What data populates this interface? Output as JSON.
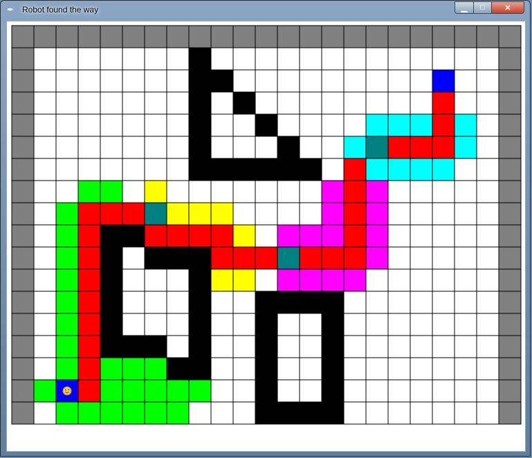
{
  "window": {
    "title": "Robot found the way",
    "icon": "feather-icon",
    "controls": [
      "minimize-icon",
      "maximize-icon",
      "close-icon"
    ]
  },
  "grid": {
    "cols": 23,
    "rows": 18,
    "legend": {
      "#": "wall",
      "W": "open",
      "B": "black-obstacle",
      "G": "green",
      "R": "red-path",
      "Y": "yellow",
      "M": "magenta",
      "C": "cyan",
      "T": "teal",
      "U": "blue-goal",
      "S": "start-robot"
    },
    "colors": {
      "#": "#808080",
      "W": "#ffffff",
      "B": "#000000",
      "G": "#00ff00",
      "R": "#ff0000",
      "Y": "#ffff00",
      "M": "#ff00ff",
      "C": "#00ffff",
      "T": "#008080",
      "U": "#0000ff",
      "S": "#0000ff"
    },
    "cells": [
      "#######################",
      "#WWWWWWWBWWWWWWWWWWWWW#",
      "#WWWWWWWBBWWWWWWWWWUWW#",
      "#WWWWWWWBWBWWWWWWWWRWW#",
      "#WWWWWWWBWWBWWWWCCCRCW#",
      "#WWWWWWWBWWWBWWCTRRRCW#",
      "#WWWWWWWBBBBBBWRCCCCWW#",
      "#WWGGWYWWWWWWWMRMWWWWW#",
      "#WGRRRTYYYWWWWMRMWWWWW#",
      "#WGRBBRRRRYWMMMRMWWWWW#",
      "#WGRBWBBBRRRTRRRMWWWWW#",
      "#WGRBWWWBYYWMMMMWWWWWW#",
      "#WGRBWWWBWWBBBBWWWWWWW#",
      "#WGRBWWWBWWBWWBWWWWWWW#",
      "#WGRBBBWBWWBWWBWWWWWWW#",
      "#WGRGGGBBWWBWWBWWWWWWW#",
      "#GSRGGGGGWWBWWBWWWWWWW#",
      "#WGGGGGGWWWBBBBWWWWWWW#",
      "#######################"
    ],
    "robot": {
      "row": 16,
      "col": 2,
      "icon": "robot-face-icon"
    }
  }
}
